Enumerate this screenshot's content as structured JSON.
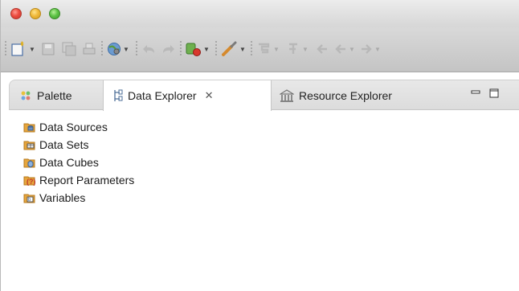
{
  "toolbar": {
    "icons": [
      "new-dropdown-icon",
      "save-icon",
      "save-all-icon",
      "print-icon",
      "globe-dropdown-icon",
      "undo-icon",
      "redo-icon",
      "run-dropdown-icon",
      "brush-dropdown-icon",
      "toolbar-icon",
      "toolbar-icon",
      "back-icon",
      "back-dropdown-icon",
      "forward-dropdown-icon"
    ]
  },
  "tabs": [
    {
      "label": "Palette",
      "icon": "palette-icon",
      "active": false
    },
    {
      "label": "Data Explorer",
      "icon": "data-explorer-icon",
      "active": true,
      "close": "✕"
    },
    {
      "label": "Resource Explorer",
      "icon": "resource-explorer-icon",
      "active": false
    }
  ],
  "view_buttons": {
    "minimize": "−",
    "maximize": "□"
  },
  "tree": [
    {
      "label": "Data Sources",
      "icon": "data-sources-icon"
    },
    {
      "label": "Data Sets",
      "icon": "data-sets-icon"
    },
    {
      "label": "Data Cubes",
      "icon": "data-cubes-icon"
    },
    {
      "label": "Report Parameters",
      "icon": "report-parameters-icon"
    },
    {
      "label": "Variables",
      "icon": "variables-icon"
    }
  ],
  "colors": {
    "folder": "#e6a53c",
    "folder_dark": "#b77a1e",
    "disabled": "#b0b0b0"
  }
}
